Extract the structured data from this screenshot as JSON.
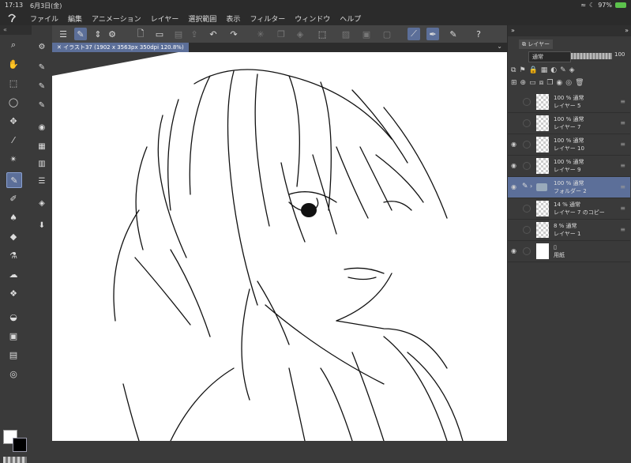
{
  "status": {
    "time": "17:13",
    "date": "6月3日(金)",
    "battery": "97%"
  },
  "menu": {
    "items": [
      "ファイル",
      "編集",
      "アニメーション",
      "レイヤー",
      "選択範囲",
      "表示",
      "フィルター",
      "ウィンドウ",
      "ヘルプ"
    ]
  },
  "document": {
    "tab_title": "イラスト37 (1902 x 3563px 350dpi 120.8%)"
  },
  "panel": {
    "tab_label": "レイヤー",
    "blend_mode": "通常",
    "opacity": "100",
    "layers": [
      {
        "opacity_mode": "100 % 通常",
        "name": "レイヤー 5",
        "visible": false,
        "selected": false,
        "kind": "raster"
      },
      {
        "opacity_mode": "100 % 通常",
        "name": "レイヤー 7",
        "visible": false,
        "selected": false,
        "kind": "raster"
      },
      {
        "opacity_mode": "100 % 通常",
        "name": "レイヤー 10",
        "visible": true,
        "selected": false,
        "kind": "raster"
      },
      {
        "opacity_mode": "100 % 通常",
        "name": "レイヤー 9",
        "visible": true,
        "selected": false,
        "kind": "raster"
      },
      {
        "opacity_mode": "100 % 通常",
        "name": "フォルダー 2",
        "visible": true,
        "selected": true,
        "kind": "folder"
      },
      {
        "opacity_mode": "14 % 通常",
        "name": "レイヤー 7 のコピー",
        "visible": false,
        "selected": false,
        "kind": "raster"
      },
      {
        "opacity_mode": "8 % 通常",
        "name": "レイヤー 1",
        "visible": false,
        "selected": false,
        "kind": "raster"
      },
      {
        "opacity_mode": "",
        "name": "用紙",
        "visible": true,
        "selected": false,
        "kind": "paper"
      }
    ]
  },
  "colors": {
    "accent": "#5c6f99",
    "main_color": "#ffffff",
    "sub_color": "#000000"
  }
}
